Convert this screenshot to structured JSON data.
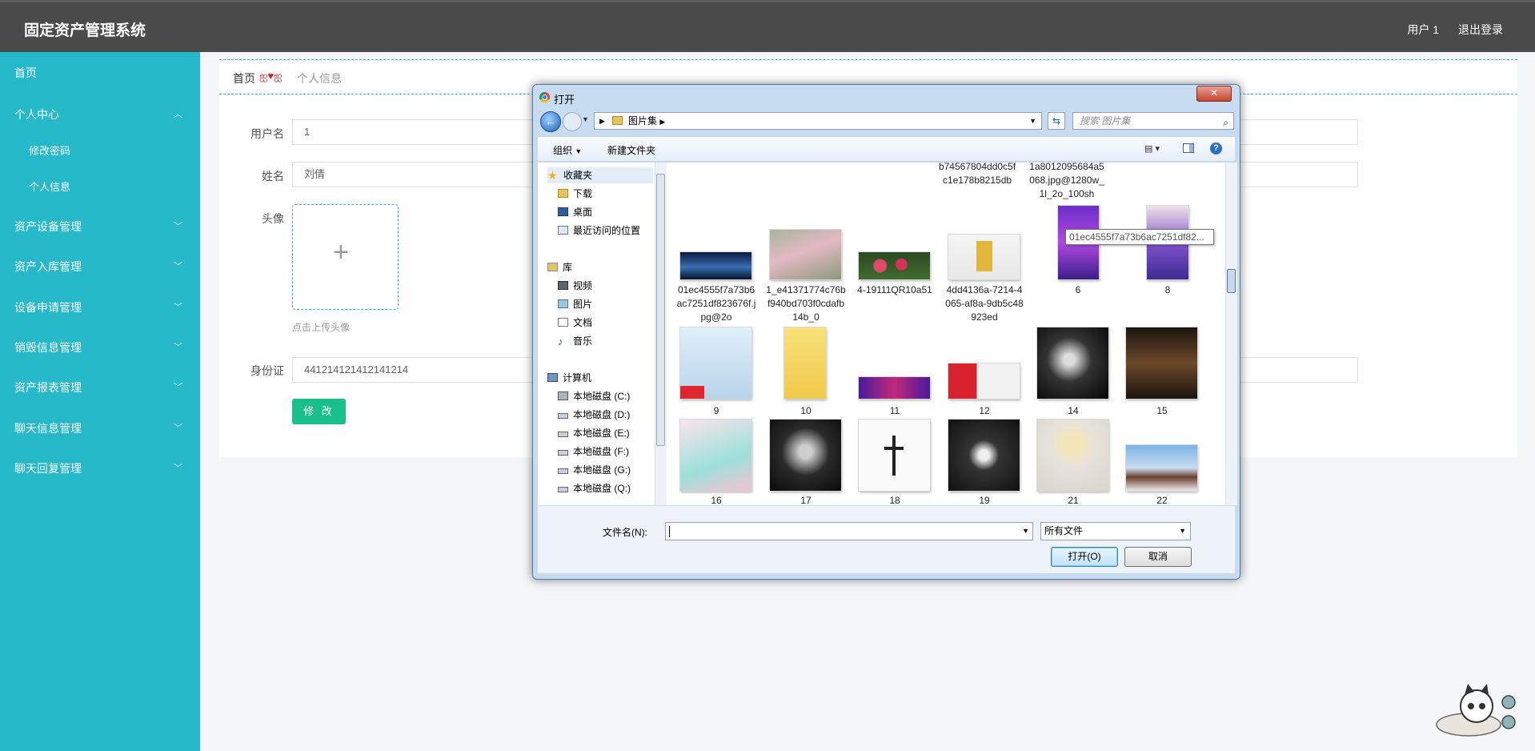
{
  "app": {
    "title": "固定资产管理系统",
    "user": "用户 1",
    "logout": "退出登录"
  },
  "sidebar": {
    "items": [
      {
        "label": "首页"
      },
      {
        "label": "个人中心"
      },
      {
        "label": "修改密码"
      },
      {
        "label": "个人信息"
      },
      {
        "label": "资产设备管理"
      },
      {
        "label": "资产入库管理"
      },
      {
        "label": "设备申请管理"
      },
      {
        "label": "销毁信息管理"
      },
      {
        "label": "资产报表管理"
      },
      {
        "label": "聊天信息管理"
      },
      {
        "label": "聊天回复管理"
      }
    ]
  },
  "breadcrumb": {
    "home": "首页",
    "separator": "ஐ♥ஐ",
    "current": "个人信息"
  },
  "form": {
    "username_label": "用户名",
    "username_value": "1",
    "name_label": "姓名",
    "name_value": "刘倩",
    "avatar_label": "头像",
    "avatar_hint": "点击上传头像",
    "id_label": "身份证",
    "id_value": "441214121412141214",
    "modify_button": "修 改"
  },
  "dialog": {
    "title": "打开",
    "close": "✕",
    "path": "图片集",
    "search_placeholder": "搜索 图片集",
    "organize": "组织",
    "new_folder": "新建文件夹",
    "nav": {
      "favorites": "收藏夹",
      "downloads": "下载",
      "desktop": "桌面",
      "recent": "最近访问的位置",
      "library": "库",
      "videos": "视频",
      "pictures": "图片",
      "documents": "文档",
      "music": "音乐",
      "computer": "计算机",
      "disk_c": "本地磁盘 (C:)",
      "disk_d": "本地磁盘 (D:)",
      "disk_e": "本地磁盘 (E:)",
      "disk_f": "本地磁盘 (F:)",
      "disk_g": "本地磁盘 (G:)",
      "disk_q": "本地磁盘 (Q:)"
    },
    "files": [
      {
        "name": "b74567804dd0c5fc1e178b8215db"
      },
      {
        "name": "1a8012095684a5068.jpg@1280w_1l_2o_100sh"
      },
      {
        "name": "01ec4555f7a73b6ac7251df823676f.jpg@2o"
      },
      {
        "name": "1_e41371774c76bf940bd703f0cdafb14b_0"
      },
      {
        "name": "4-19111QR10a51"
      },
      {
        "name": "4dd4136a-7214-4065-af8a-9db5c48923ed"
      },
      {
        "name": "6"
      },
      {
        "name": "8"
      },
      {
        "name": "9"
      },
      {
        "name": "10"
      },
      {
        "name": "11"
      },
      {
        "name": "12"
      },
      {
        "name": "14"
      },
      {
        "name": "15"
      },
      {
        "name": "16"
      },
      {
        "name": "17"
      },
      {
        "name": "18"
      },
      {
        "name": "19"
      },
      {
        "name": "21"
      },
      {
        "name": "22"
      }
    ],
    "tooltip": "01ec4555f7a73b6ac7251df82...",
    "filename_label": "文件名(N):",
    "filename_value": "",
    "filetype": "所有文件",
    "open_button": "打开(O)",
    "cancel_button": "取消"
  }
}
